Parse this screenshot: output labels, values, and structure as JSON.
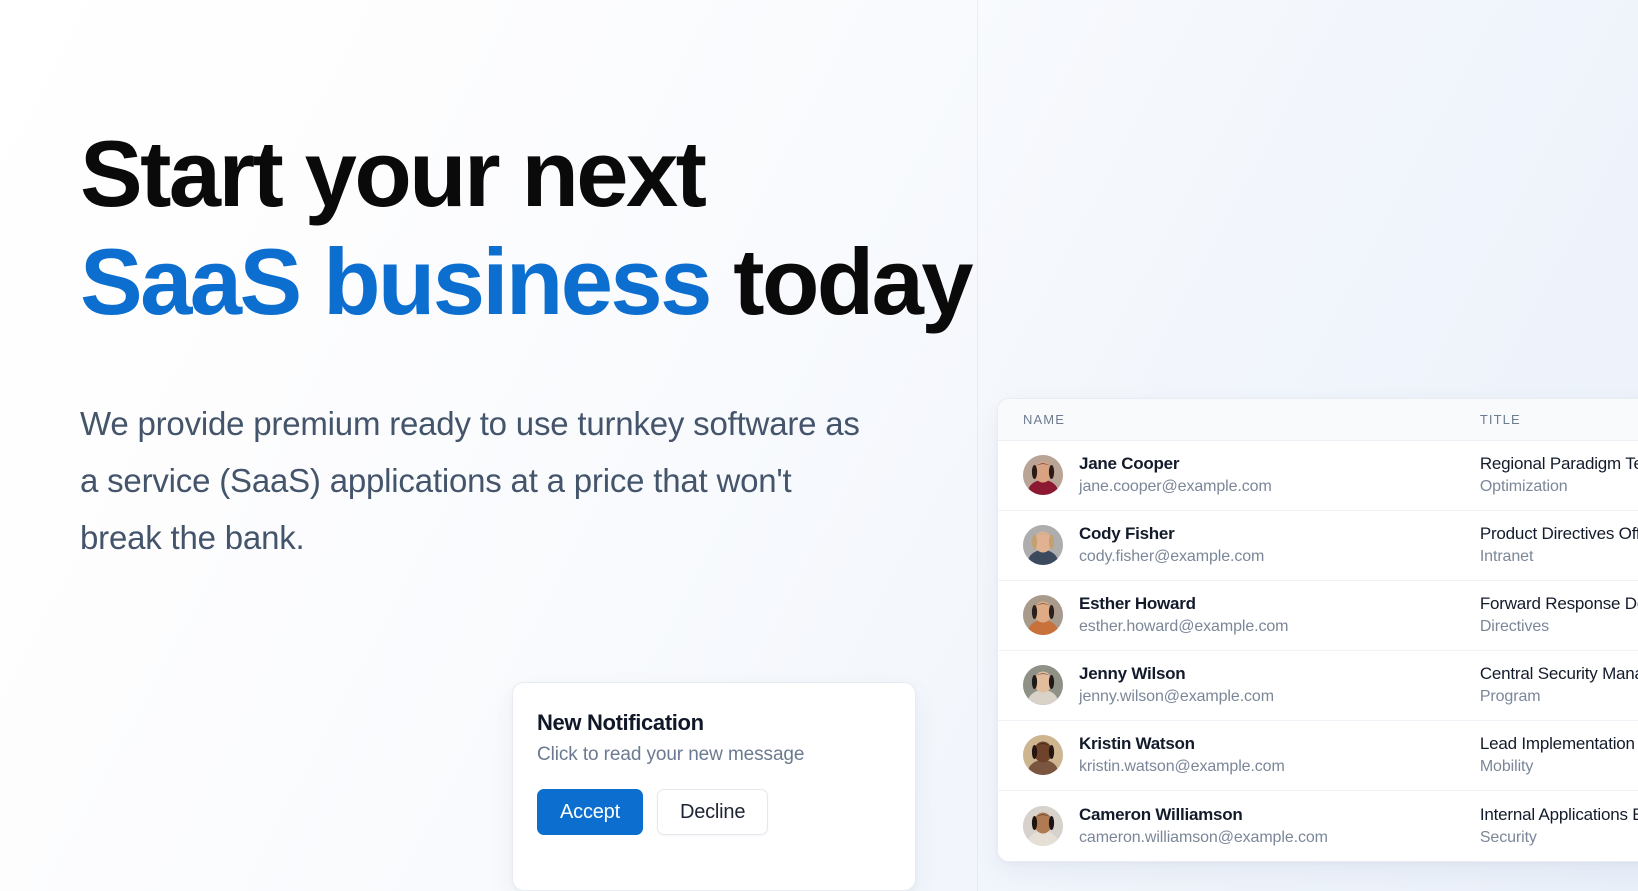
{
  "theme": {
    "accent_blue": "#0c6fd0",
    "headline_black": "#0a0a0a",
    "body_text": "#44556b",
    "muted_text": "#7b8798",
    "card_bg": "#ffffff",
    "page_bg": "#f2f6fc"
  },
  "hero": {
    "headline_line1": "Start your next",
    "headline_accent": "SaaS business",
    "headline_line2_tail": " today",
    "subcopy": "We provide premium ready to use turnkey software as a service (SaaS) applications at a price that won't break the bank."
  },
  "notification": {
    "title": "New Notification",
    "subtitle": "Click to read your new message",
    "accept_label": "Accept",
    "decline_label": "Decline"
  },
  "people_table": {
    "columns": [
      "NAME",
      "TITLE"
    ],
    "rows": [
      {
        "name": "Jane Cooper",
        "email": "jane.cooper@example.com",
        "title": "Regional Paradigm Technician",
        "department": "Optimization",
        "avatar_skin": "#d9a282",
        "avatar_hair": "#2b1a16",
        "avatar_shirt": "#8c1832",
        "avatar_bg": "#b9a496"
      },
      {
        "name": "Cody Fisher",
        "email": "cody.fisher@example.com",
        "title": "Product Directives Officer",
        "department": "Intranet",
        "avatar_skin": "#e0b292",
        "avatar_hair": "#c2a071",
        "avatar_shirt": "#3c4a5e",
        "avatar_bg": "#adadad"
      },
      {
        "name": "Esther Howard",
        "email": "esther.howard@example.com",
        "title": "Forward Response Developer",
        "department": "Directives",
        "avatar_skin": "#deab86",
        "avatar_hair": "#2c201c",
        "avatar_shirt": "#c9713a",
        "avatar_bg": "#a89b8c"
      },
      {
        "name": "Jenny Wilson",
        "email": "jenny.wilson@example.com",
        "title": "Central Security Manager",
        "department": "Program",
        "avatar_skin": "#e2bc9c",
        "avatar_hair": "#1f1a18",
        "avatar_shirt": "#d8d2c8",
        "avatar_bg": "#8f9187"
      },
      {
        "name": "Kristin Watson",
        "email": "kristin.watson@example.com",
        "title": "Lead Implementation Liaison",
        "department": "Mobility",
        "avatar_skin": "#6e4329",
        "avatar_hair": "#241512",
        "avatar_shirt": "#7a5540",
        "avatar_bg": "#cdb68f"
      },
      {
        "name": "Cameron Williamson",
        "email": "cameron.williamson@example.com",
        "title": "Internal Applications Engineer",
        "department": "Security",
        "avatar_skin": "#b07b52",
        "avatar_hair": "#1d1512",
        "avatar_shirt": "#e6dfd6",
        "avatar_bg": "#d7d2cb"
      }
    ]
  }
}
